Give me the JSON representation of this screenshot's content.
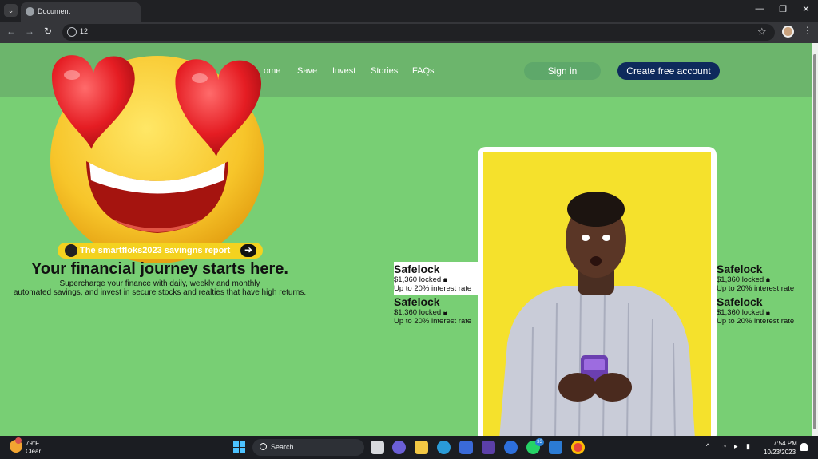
{
  "browser": {
    "tab_title": "Document",
    "address": "12",
    "win_minimize": "—",
    "win_restore": "❐",
    "win_close": "✕",
    "back_icon": "←",
    "forward_icon": "→",
    "reload_icon": "↻",
    "star_icon": "☆",
    "menu_icon": "⋮",
    "tab_menu_icon": "⌄"
  },
  "header": {
    "nav": [
      "ome",
      "Save",
      "Invest",
      "Stories",
      "FAQs"
    ],
    "signin_label": "Sign in",
    "create_label": "Create free account"
  },
  "hero": {
    "pill_text": "The smartfloks2023 savingns report",
    "pill_arrow": "➔",
    "title": "Your financial journey starts here.",
    "subtitle_line1": "Supercharge your finance with daily, weekly and monthly",
    "subtitle_line2": "automated savings, and invest in secure stocks and realties that have high returns."
  },
  "stats": [
    {
      "title": "Safelock",
      "locked": "$1,360 locked",
      "rate": "Up to 20% interest rate"
    },
    {
      "title": "Safelock",
      "locked": "$1,360 locked",
      "rate": "Up to 20% interest rate"
    },
    {
      "title": "Safelock",
      "locked": "$1,360 locked",
      "rate": "Up to 20% interest rate"
    },
    {
      "title": "Safelock",
      "locked": "$1,360 locked",
      "rate": "Up to 20% interest rate"
    }
  ],
  "taskbar": {
    "weather_temp": "79°F",
    "weather_desc": "Clear",
    "search_label": "Search",
    "whatsapp_badge": "33",
    "tray_chevron": "^",
    "clock_time": "7:54 PM",
    "clock_date": "10/23/2023"
  },
  "colors": {
    "page_green": "#78cf74",
    "header_green": "#6cb56c",
    "navy": "#0e2a5c",
    "yellow": "#f4d21f",
    "photo_yellow": "#f5e12c"
  }
}
